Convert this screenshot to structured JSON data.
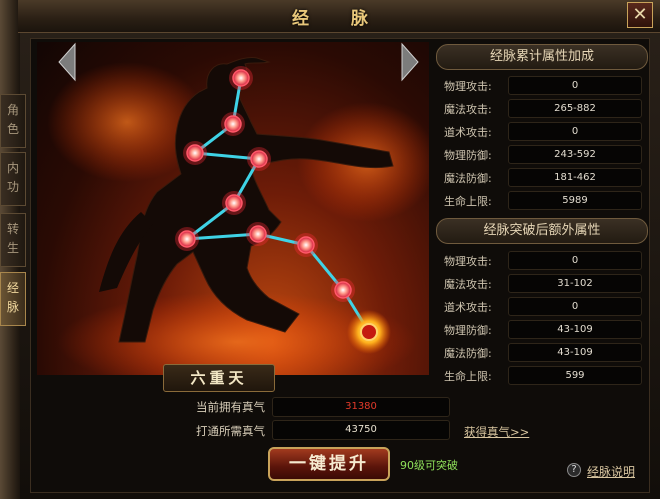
{
  "window": {
    "title": "经 脉",
    "close_symbol": "✕"
  },
  "tabs": [
    {
      "label": "角\n色",
      "active": false
    },
    {
      "label": "内\n功",
      "active": false
    },
    {
      "label": "转\n生",
      "active": false
    },
    {
      "label": "经\n脉",
      "active": true
    }
  ],
  "stage": {
    "name": "六重天"
  },
  "cumulative": {
    "title": "经脉累计属性加成",
    "rows": [
      {
        "label": "物理攻击:",
        "value": "0"
      },
      {
        "label": "魔法攻击:",
        "value": "265-882"
      },
      {
        "label": "道术攻击:",
        "value": "0"
      },
      {
        "label": "物理防御:",
        "value": "243-592"
      },
      {
        "label": "魔法防御:",
        "value": "181-462"
      },
      {
        "label": "生命上限:",
        "value": "5989"
      }
    ]
  },
  "breakthrough": {
    "title": "经脉突破后额外属性",
    "rows": [
      {
        "label": "物理攻击:",
        "value": "0"
      },
      {
        "label": "魔法攻击:",
        "value": "31-102"
      },
      {
        "label": "道术攻击:",
        "value": "0"
      },
      {
        "label": "物理防御:",
        "value": "43-109"
      },
      {
        "label": "魔法防御:",
        "value": "43-109"
      },
      {
        "label": "生命上限:",
        "value": "599"
      }
    ]
  },
  "qi": {
    "current_label": "当前拥有真气",
    "current_value": "31380",
    "required_label": "打通所需真气",
    "required_value": "43750",
    "get_link": "获得真气>>"
  },
  "actions": {
    "upgrade_label": "一键提升",
    "break_hint": "90级可突破",
    "help_icon": "?",
    "help_label": "经脉说明"
  },
  "colors": {
    "accent": "#e8c77a",
    "current_value": "#e23a2a",
    "hint": "#8fe05a",
    "meridian_line": "#3fd3e6"
  },
  "meridian_points": 9,
  "icons": [
    "close-icon",
    "arrow-left-icon",
    "arrow-right-icon",
    "acupoint-node-icon",
    "active-acupoint-icon",
    "help-icon"
  ]
}
